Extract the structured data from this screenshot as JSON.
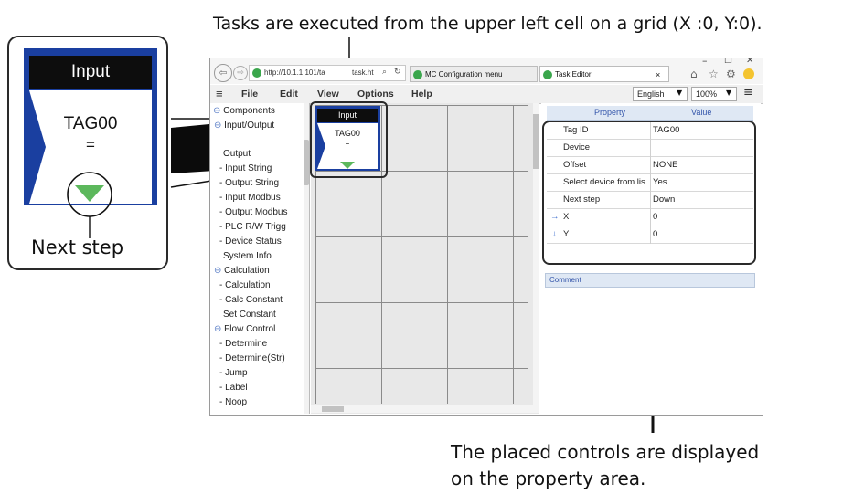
{
  "captions": {
    "top": "Tasks are executed from the upper left cell on a grid (X :0, Y:0).",
    "bottom_line1": "The placed controls are displayed",
    "bottom_line2": "on the property area."
  },
  "zoom_callout": {
    "block_header": "Input",
    "block_tag": "TAG00",
    "block_eq": "=",
    "label": "Next step"
  },
  "browser": {
    "address": "http://10.1.1.101/ta",
    "address_tail": "task.ht",
    "tabs": [
      "MC Configuration menu",
      "Task Editor"
    ],
    "window_controls": [
      "–",
      "☐",
      "✕"
    ]
  },
  "menubar": {
    "items": [
      "File",
      "Edit",
      "View",
      "Options",
      "Help"
    ],
    "language": "English",
    "zoom": "100%"
  },
  "tree": {
    "root": "Components",
    "groups": [
      {
        "label": "Input/Output",
        "items": [
          "Output",
          "Input String",
          "Output String",
          "Input Modbus",
          "Output Modbus",
          "PLC R/W Trigg",
          "Device Status",
          "System Info"
        ]
      },
      {
        "label": "Calculation",
        "items": [
          "Calculation",
          "Calc Constant",
          "Set Constant"
        ]
      },
      {
        "label": "Flow Control",
        "items": [
          "Determine",
          "Determine(Str)",
          "Jump",
          "Label",
          "Noop"
        ]
      }
    ]
  },
  "grid_block": {
    "header": "Input",
    "tag": "TAG00",
    "eq": "="
  },
  "properties": {
    "col_property": "Property",
    "col_value": "Value",
    "rows": [
      {
        "name": "Tag ID",
        "value": "TAG00"
      },
      {
        "name": "Device",
        "value": ""
      },
      {
        "name": "Offset",
        "value": "NONE"
      },
      {
        "name": "Select device from lis",
        "value": "Yes"
      },
      {
        "name": "Next step",
        "value": "Down"
      },
      {
        "name": "X",
        "value": "0"
      },
      {
        "name": "Y",
        "value": "0"
      }
    ],
    "comment_label": "Comment"
  },
  "colors": {
    "block_blue": "#1a3fa0",
    "block_header": "#0d0d0d",
    "arrow_green": "#5cb85c",
    "callout_border": "#2a2a2a"
  }
}
